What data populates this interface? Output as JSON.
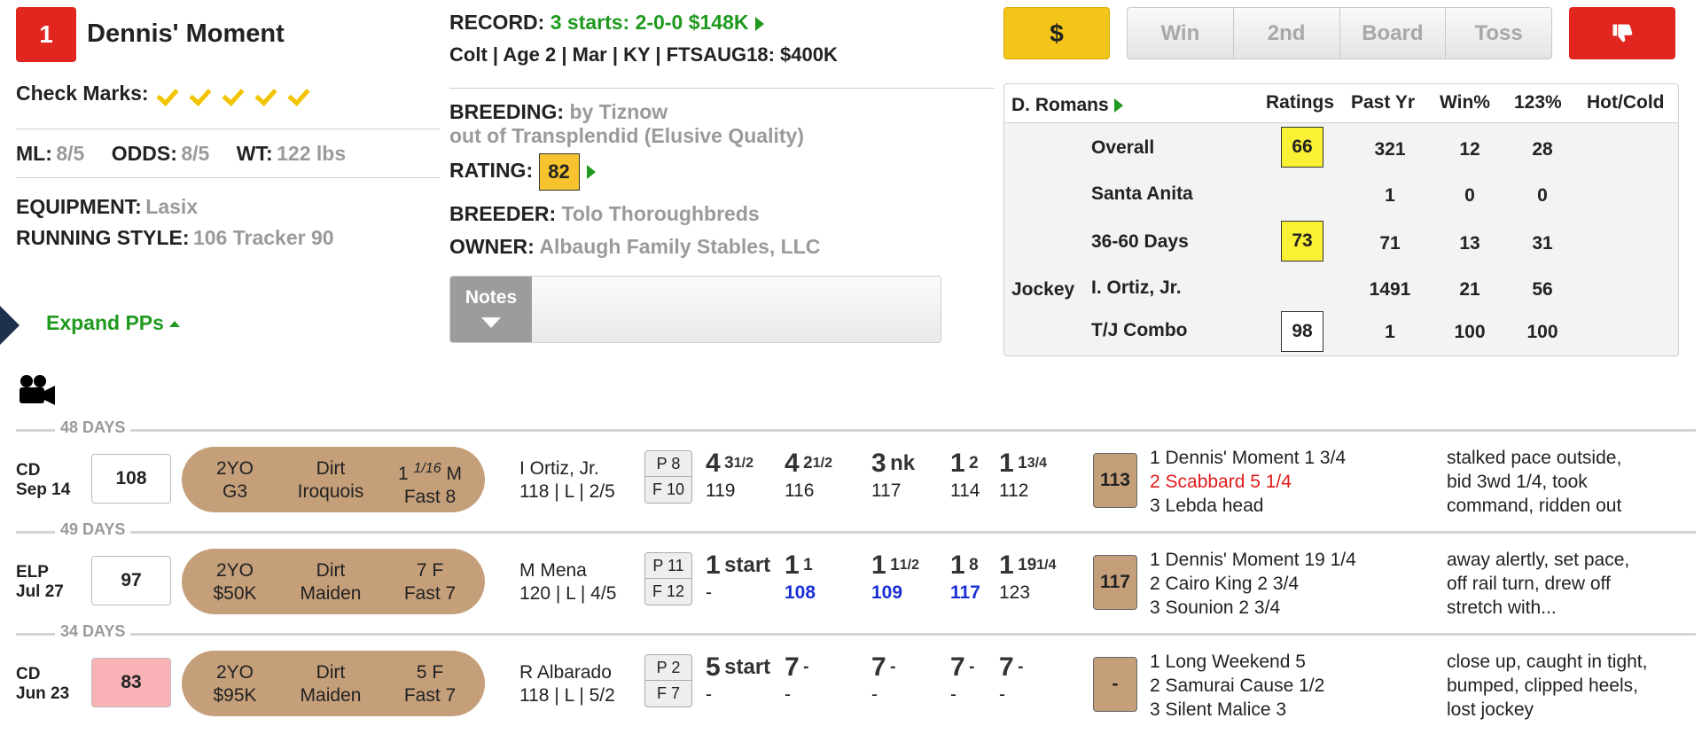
{
  "horse": {
    "program_number": "1",
    "name": "Dennis' Moment",
    "check_marks_label": "Check Marks:",
    "check_marks_count": 5,
    "ml_label": "ML:",
    "ml_value": "8/5",
    "odds_label": "ODDS:",
    "odds_value": "8/5",
    "wt_label": "WT:",
    "wt_value": "122 lbs",
    "equipment_label": "EQUIPMENT:",
    "equipment_value": "Lasix",
    "running_style_label": "RUNNING STYLE:",
    "running_style_value": "106 Tracker 90",
    "expand_label": "Expand PPs"
  },
  "record": {
    "label": "RECORD:",
    "value": "3 starts: 2-0-0 $148K",
    "details": "Colt | Age 2 | Mar | KY | FTSAUG18: $400K"
  },
  "breeding": {
    "label": "BREEDING:",
    "sire": "by Tiznow",
    "dam": "out of Transplendid (Elusive Quality)",
    "rating_label": "RATING:",
    "rating_value": "82",
    "breeder_label": "BREEDER:",
    "breeder_value": "Tolo Thoroughbreds",
    "owner_label": "OWNER:",
    "owner_value": "Albaugh Family Stables, LLC",
    "notes_label": "Notes"
  },
  "buttons": {
    "dollar": "$",
    "win": "Win",
    "second": "2nd",
    "board": "Board",
    "toss": "Toss"
  },
  "stats": {
    "trainer": "D. Romans",
    "headers": {
      "ratings": "Ratings",
      "past_yr": "Past Yr",
      "win_pct": "Win%",
      "itm_pct": "123%",
      "hot_cold": "Hot/Cold"
    },
    "jockey_label": "Jockey",
    "rows": [
      {
        "label": "Overall",
        "rating": "66",
        "past_yr": "321",
        "win": "12",
        "itm": "28"
      },
      {
        "label": "Santa Anita",
        "rating": "",
        "past_yr": "1",
        "win": "0",
        "itm": "0"
      },
      {
        "label": "36-60 Days",
        "rating": "73",
        "past_yr": "71",
        "win": "13",
        "itm": "31"
      },
      {
        "label": "I. Ortiz, Jr.",
        "rating": "",
        "past_yr": "1491",
        "win": "21",
        "itm": "56"
      },
      {
        "label": "T/J Combo",
        "rating": "98",
        "past_yr": "1",
        "win": "100",
        "itm": "100"
      }
    ]
  },
  "past_performances": [
    {
      "days": "48 DAYS",
      "track": "CD",
      "date": "Sep 14",
      "speed": "108",
      "age": "2YO",
      "class": "G3",
      "surface": "Dirt",
      "race": "Iroquois",
      "dist_whole": "1",
      "dist_frac": "1/16",
      "dist_unit": "M",
      "cond": "Fast 8",
      "jockey": "I Ortiz, Jr.",
      "jockey_line2": "118 | L | 2/5",
      "post": "P 8",
      "field": "F 10",
      "calls": [
        {
          "pos": "4",
          "margin": "3",
          "frac": "1/2",
          "fig": "119"
        },
        {
          "pos": "4",
          "margin": "2",
          "frac": "1/2",
          "fig": "116"
        },
        {
          "pos": "3",
          "margin": "nk",
          "frac": "",
          "fig": "117"
        },
        {
          "pos": "1",
          "margin": "2",
          "frac": "",
          "fig": "114"
        },
        {
          "pos": "1",
          "margin": "1",
          "frac": "3/4",
          "fig": "112"
        }
      ],
      "beyer": "113",
      "finish": [
        "1 Dennis' Moment 1 3/4",
        "2 Scabbard 5 1/4",
        "3 Lebda head"
      ],
      "comment": [
        "stalked pace outside,",
        "bid 3wd 1/4, took",
        "command, ridden out"
      ]
    },
    {
      "days": "49 DAYS",
      "track": "ELP",
      "date": "Jul 27",
      "speed": "97",
      "age": "2YO",
      "class": "$50K",
      "surface": "Dirt",
      "race": "Maiden",
      "dist_whole": "7 F",
      "dist_frac": "",
      "dist_unit": "",
      "cond": "Fast 7",
      "jockey": "M Mena",
      "jockey_line2": "120 | L | 4/5",
      "post": "P 11",
      "field": "F 12",
      "calls": [
        {
          "pos": "1",
          "margin": "start",
          "frac": "",
          "fig": "-"
        },
        {
          "pos": "1",
          "margin": "1",
          "frac": "",
          "fig": "108"
        },
        {
          "pos": "1",
          "margin": "1",
          "frac": "1/2",
          "fig": "109"
        },
        {
          "pos": "1",
          "margin": "8",
          "frac": "",
          "fig": "117"
        },
        {
          "pos": "1",
          "margin": "19",
          "frac": "1/4",
          "fig": "123"
        }
      ],
      "beyer": "117",
      "finish": [
        "1 Dennis' Moment 19 1/4",
        "2 Cairo King 2 3/4",
        "3 Sounion 2 3/4"
      ],
      "comment": [
        "away alertly, set pace,",
        "off rail turn, drew off",
        "stretch with..."
      ]
    },
    {
      "days": "34 DAYS",
      "track": "CD",
      "date": "Jun 23",
      "speed": "83",
      "age": "2YO",
      "class": "$95K",
      "surface": "Dirt",
      "race": "Maiden",
      "dist_whole": "5 F",
      "dist_frac": "",
      "dist_unit": "",
      "cond": "Fast 7",
      "jockey": "R Albarado",
      "jockey_line2": "118 | L | 5/2",
      "post": "P 2",
      "field": "F 7",
      "calls": [
        {
          "pos": "5",
          "margin": "start",
          "frac": "",
          "fig": "-"
        },
        {
          "pos": "7",
          "margin": "-",
          "frac": "",
          "fig": "-"
        },
        {
          "pos": "7",
          "margin": "-",
          "frac": "",
          "fig": "-"
        },
        {
          "pos": "7",
          "margin": "-",
          "frac": "",
          "fig": "-"
        },
        {
          "pos": "7",
          "margin": "-",
          "frac": "",
          "fig": "-"
        }
      ],
      "beyer": "-",
      "finish": [
        "1 Long Weekend 5",
        "2 Samurai Cause 1/2",
        "3 Silent Malice 3"
      ],
      "comment": [
        "close up, caught in tight,",
        "bumped, clipped heels,",
        "lost jockey"
      ]
    }
  ],
  "colors": {
    "brand_red": "#e0261f",
    "gold": "#f3c51a",
    "green": "#1f9a1f",
    "tan": "#c49f7a",
    "rating_yellow": "#fbf134",
    "pink": "#f9b3b6",
    "blue_fig": "#1a2fd6",
    "red_text": "#e21b1b"
  }
}
